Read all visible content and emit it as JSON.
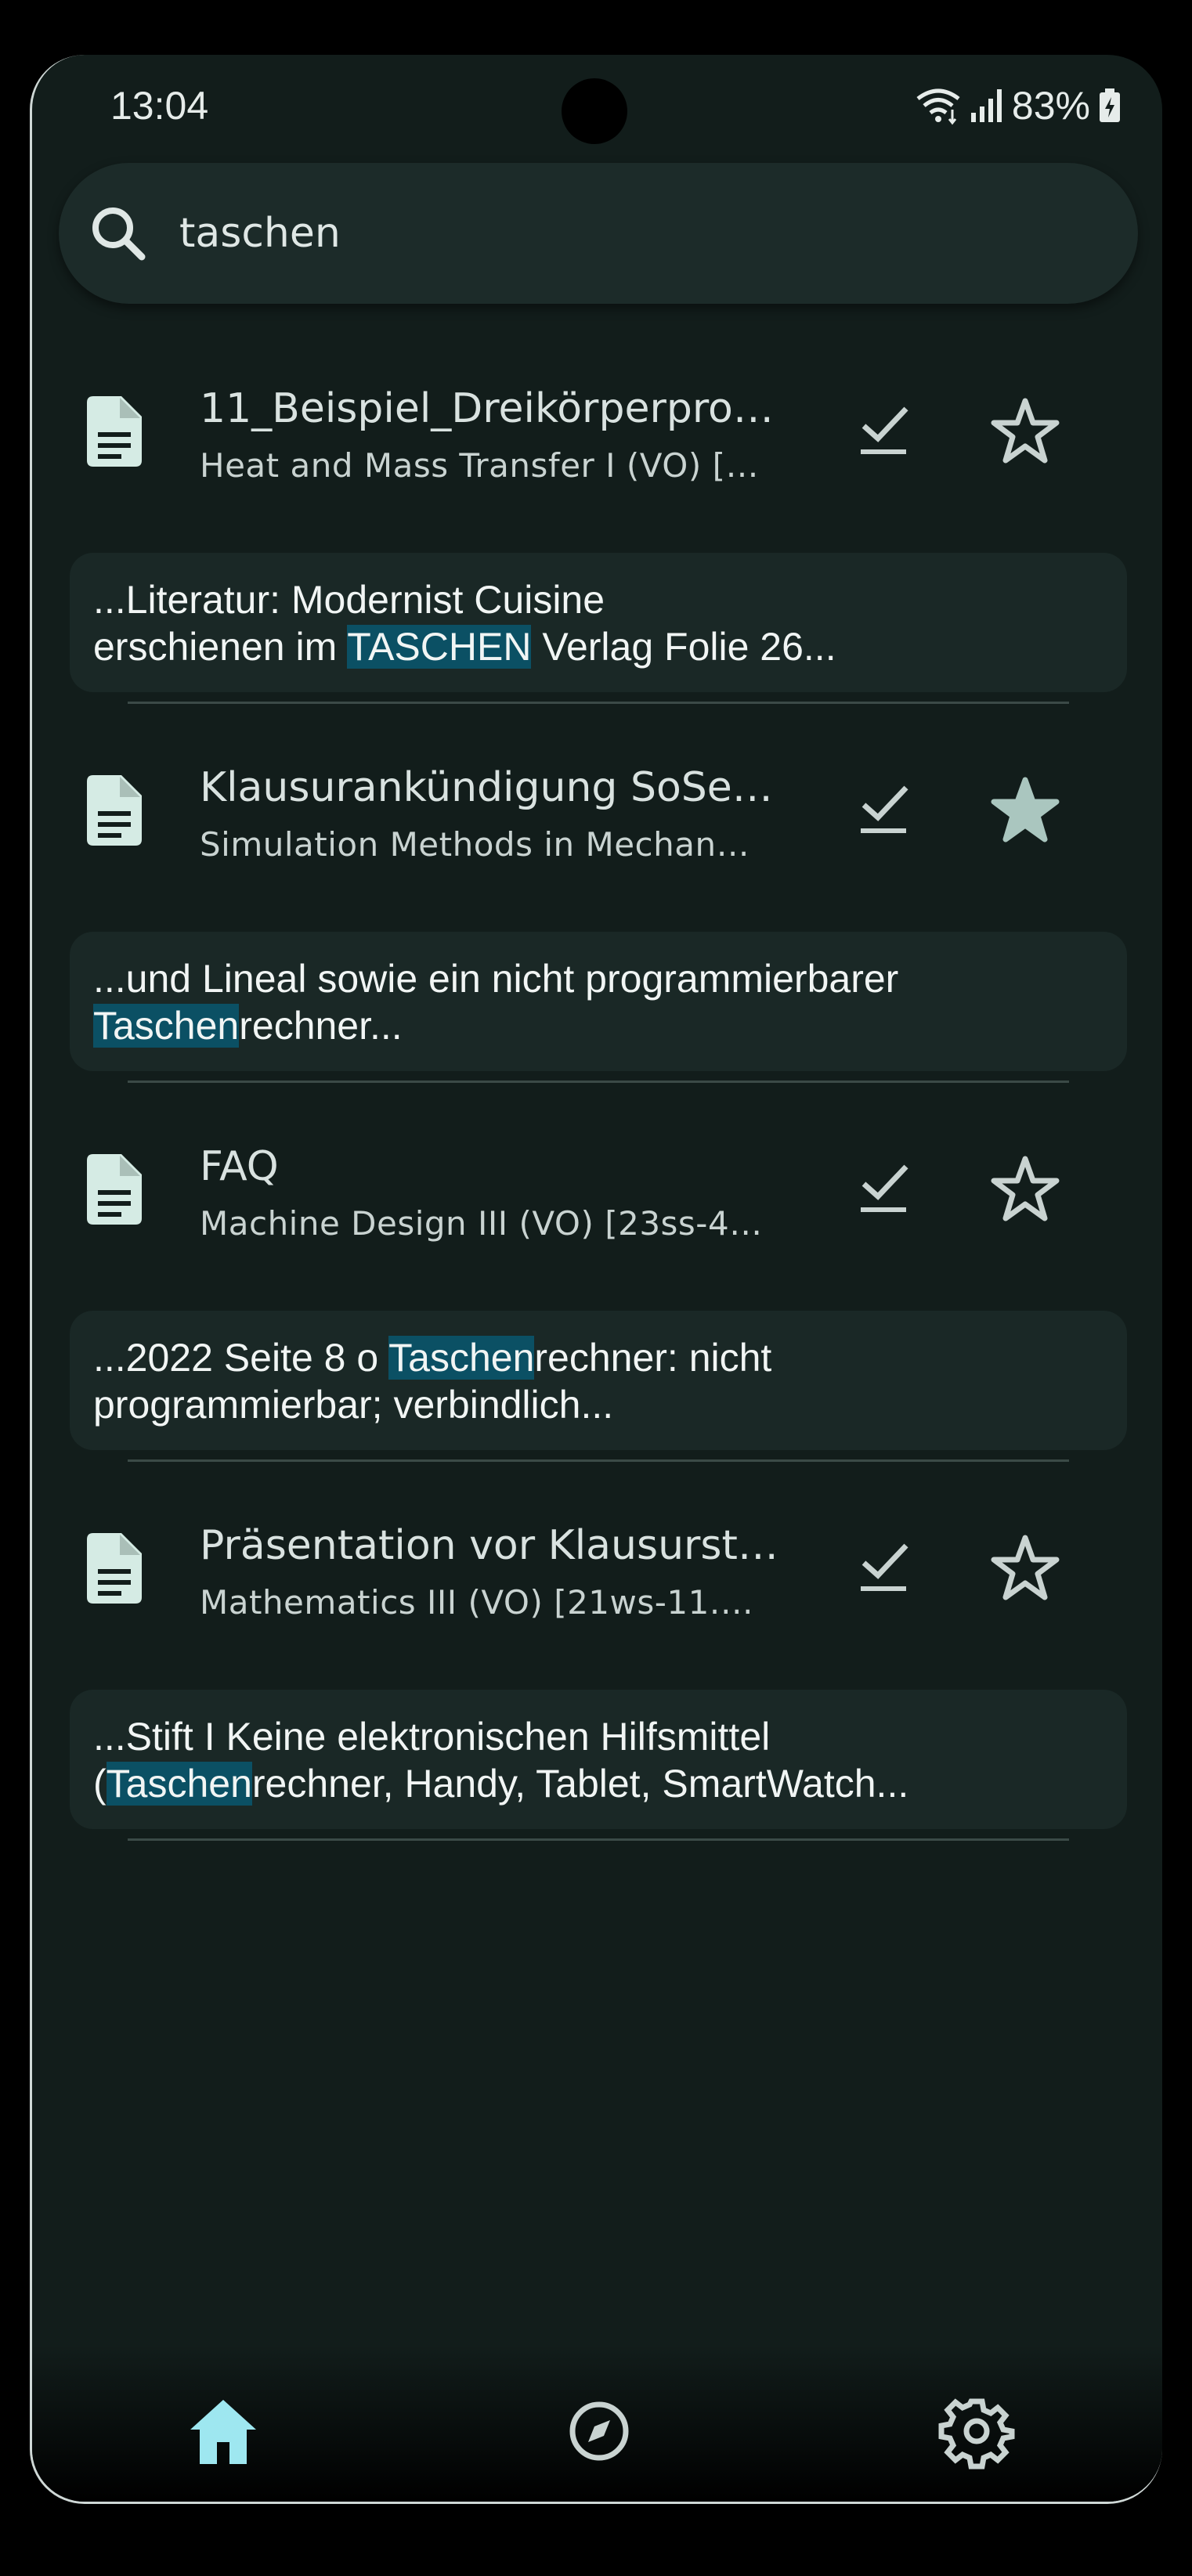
{
  "status_bar": {
    "time": "13:04",
    "battery": "83%"
  },
  "search": {
    "query": "taschen"
  },
  "results": [
    {
      "title": "11_Beispiel_Dreikörperpro…",
      "subtitle": "Heat and Mass Transfer I (VO) […",
      "starred": false,
      "snippet_pre": "...Literatur: Modernist Cuisine",
      "snippet_line2_pre": "erschienen im ",
      "snippet_hl": "TASCHEN",
      "snippet_post": " Verlag Folie 26..."
    },
    {
      "title": "Klausurankündigung SoSe…",
      "subtitle": "Simulation Methods in Mechan…",
      "starred": true,
      "snippet_pre": "...und Lineal sowie ein nicht programmierbarer",
      "snippet_line2_pre": "",
      "snippet_hl": "Taschen",
      "snippet_post": "rechner..."
    },
    {
      "title": "FAQ",
      "subtitle": "Machine Design III (VO) [23ss-4…",
      "starred": false,
      "snippet_pre": "...2022 Seite 8  o ",
      "snippet_hl": "Taschen",
      "snippet_post": "rechner: nicht",
      "snippet_line2": "programmierbar; verbindlich..."
    },
    {
      "title": "Präsentation vor Klausurst…",
      "subtitle": "Mathematics III (VO) [21ws-11.…",
      "starred": false,
      "snippet_pre": "...Stift I Keine elektronischen Hilfsmittel",
      "snippet_line2_pre": "(",
      "snippet_hl": "Taschen",
      "snippet_post": "rechner, Handy, Tablet, SmartWatch..."
    }
  ],
  "icons": {
    "search": "search-icon",
    "document": "document-icon",
    "done": "done-check-icon",
    "star": "star-icon",
    "home": "home-icon",
    "explore": "compass-icon",
    "settings": "gear-icon"
  },
  "colors": {
    "background": "#121d1b",
    "surface": "#1c2b29",
    "highlight": "#0b5064",
    "accent": "#9ee7f0"
  }
}
